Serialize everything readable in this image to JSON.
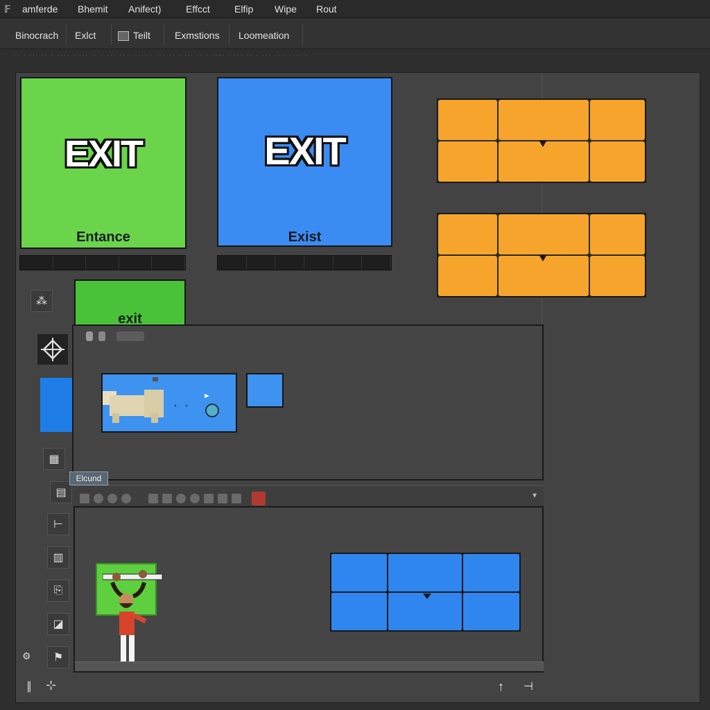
{
  "menubar": {
    "items": [
      "amferde",
      "Bhemit",
      "Anifect)",
      "Effcct",
      "Elfip",
      "Wipe",
      "Rout"
    ]
  },
  "toolbar": {
    "tabs": [
      "Binocrach",
      "Exlct",
      "Teilt",
      "Exmstions",
      "Loomeation"
    ]
  },
  "ruler_text": "·· · ··· ·· · ···· · ··· ·· · ··· ·· · ···· · ··· ·· · ··· ·· · ···· · ··· ·· · ··· ·· · ···· ·",
  "canvas": {
    "green_tile": {
      "title": "EXIT",
      "caption": "Entance",
      "color": "#6ad44b"
    },
    "blue_tile": {
      "title": "EXIT",
      "caption": "Exist",
      "color": "#3b8cf2"
    },
    "small_green_tile": {
      "caption": "exit",
      "color": "#49c23a"
    },
    "orange_color": "#f6a42c",
    "blue_cell_color": "#2f86ee",
    "layer_chip": "Elcund",
    "panel_dropdown_icon": "▾"
  },
  "tools": [
    "pattern-tool-icon",
    "diamond-select-icon",
    "color-swatch-icon",
    "grid-tool-icon",
    "layers-icon",
    "chart-icon",
    "document-icon",
    "copy-icon",
    "export-icon",
    "flag-icon"
  ],
  "bottom_icons": {
    "up": "↑",
    "bracket": "⊣",
    "glyph_left": "∥",
    "glyph_mid": "⊹"
  }
}
